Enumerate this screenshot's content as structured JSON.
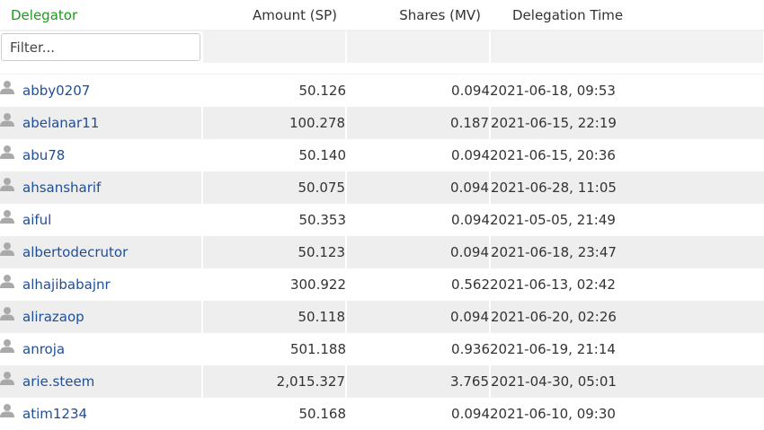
{
  "columns": {
    "delegator": "Delegator",
    "amount": "Amount (SP)",
    "shares": "Shares (MV)",
    "time": "Delegation Time"
  },
  "filter": {
    "placeholder": "Filter...",
    "value": ""
  },
  "colors": {
    "header_accent": "#1a9c1a",
    "link": "#1f4e99",
    "row_alt": "#eeeeee"
  },
  "rows": [
    {
      "user": "abby0207",
      "amount": "50.126",
      "shares": "0.094",
      "time": "2021-06-18, 09:53"
    },
    {
      "user": "abelanar11",
      "amount": "100.278",
      "shares": "0.187",
      "time": "2021-06-15, 22:19"
    },
    {
      "user": "abu78",
      "amount": "50.140",
      "shares": "0.094",
      "time": "2021-06-15, 20:36"
    },
    {
      "user": "ahsansharif",
      "amount": "50.075",
      "shares": "0.094",
      "time": "2021-06-28, 11:05"
    },
    {
      "user": "aiful",
      "amount": "50.353",
      "shares": "0.094",
      "time": "2021-05-05, 21:49"
    },
    {
      "user": "albertodecrutor",
      "amount": "50.123",
      "shares": "0.094",
      "time": "2021-06-18, 23:47"
    },
    {
      "user": "alhajibabajnr",
      "amount": "300.922",
      "shares": "0.562",
      "time": "2021-06-13, 02:42"
    },
    {
      "user": "alirazaop",
      "amount": "50.118",
      "shares": "0.094",
      "time": "2021-06-20, 02:26"
    },
    {
      "user": "anroja",
      "amount": "501.188",
      "shares": "0.936",
      "time": "2021-06-19, 21:14"
    },
    {
      "user": "arie.steem",
      "amount": "2,015.327",
      "shares": "3.765",
      "time": "2021-04-30, 05:01"
    },
    {
      "user": "atim1234",
      "amount": "50.168",
      "shares": "0.094",
      "time": "2021-06-10, 09:30"
    }
  ]
}
